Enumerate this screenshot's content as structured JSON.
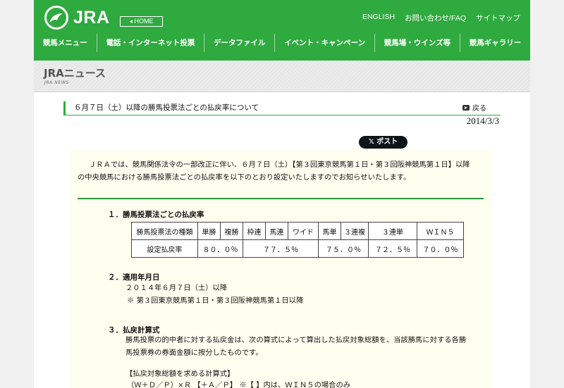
{
  "header": {
    "logo_text": "JRA",
    "home_label": "HOME",
    "util_nav": [
      "ENGLISH",
      "お問い合わせ/FAQ",
      "サイトマップ"
    ],
    "main_nav": [
      "競馬メニュー",
      "電話・インターネット投票",
      "データファイル",
      "イベント・キャンペーン",
      "競馬場・ウインズ等",
      "競馬ギャラリー"
    ],
    "brand_color": "#2eaa3f"
  },
  "section": {
    "title": "JRAニュース",
    "subtitle": "JRA NEWS"
  },
  "article": {
    "title": "６月７日（土）以降の勝馬投票法ごとの払戻率について",
    "back_label": "戻る",
    "date": "2014/3/3",
    "post_label": "ポスト",
    "intro_lines": [
      "ＪＲＡでは、競馬関係法令の一部改正に伴い、６月７日（土）【第３回東京競馬第１日・第３回阪神競馬第１日】以降",
      "の中央競馬における勝馬投票法ごとの払戻率を以下のとおり設定いたしますのでお知らせいたします。"
    ],
    "section1": {
      "heading": "１．勝馬投票法ごとの払戻率",
      "table": {
        "row1": [
          "勝馬投票法の種類",
          "単勝",
          "複勝",
          "枠連",
          "馬連",
          "ワイド",
          "馬単",
          "３連複",
          "３連単",
          "ＷＩＮ５"
        ],
        "row2_label": "設定払戻率",
        "row2_values": [
          "８０．０％",
          "７７．５％",
          "７５．０％",
          "７２．５％",
          "７０．０％"
        ]
      }
    },
    "section2": {
      "heading": "２．適用年月日",
      "line1": "２０１４年６月７日（土）以降",
      "line2": "※ 第３回東京競馬第１日・第３回阪神競馬第１日以降"
    },
    "section3": {
      "heading": "３．払戻計算式",
      "line1": "勝馬投票の的中者に対する払戻金は、次の算式によって算出した払戻対象総額を、当該勝馬に対する各勝",
      "line2": "馬投票券の券面金額に按分したものです。",
      "formula_title": "【払戻対象総額を求める計算式】",
      "formula": "（Ｗ＋Ｄ／Ｐ）×Ｒ 【＋Ａ／Ｐ】 ※【 】内は、ＷＩＮ５の場合のみ"
    }
  }
}
